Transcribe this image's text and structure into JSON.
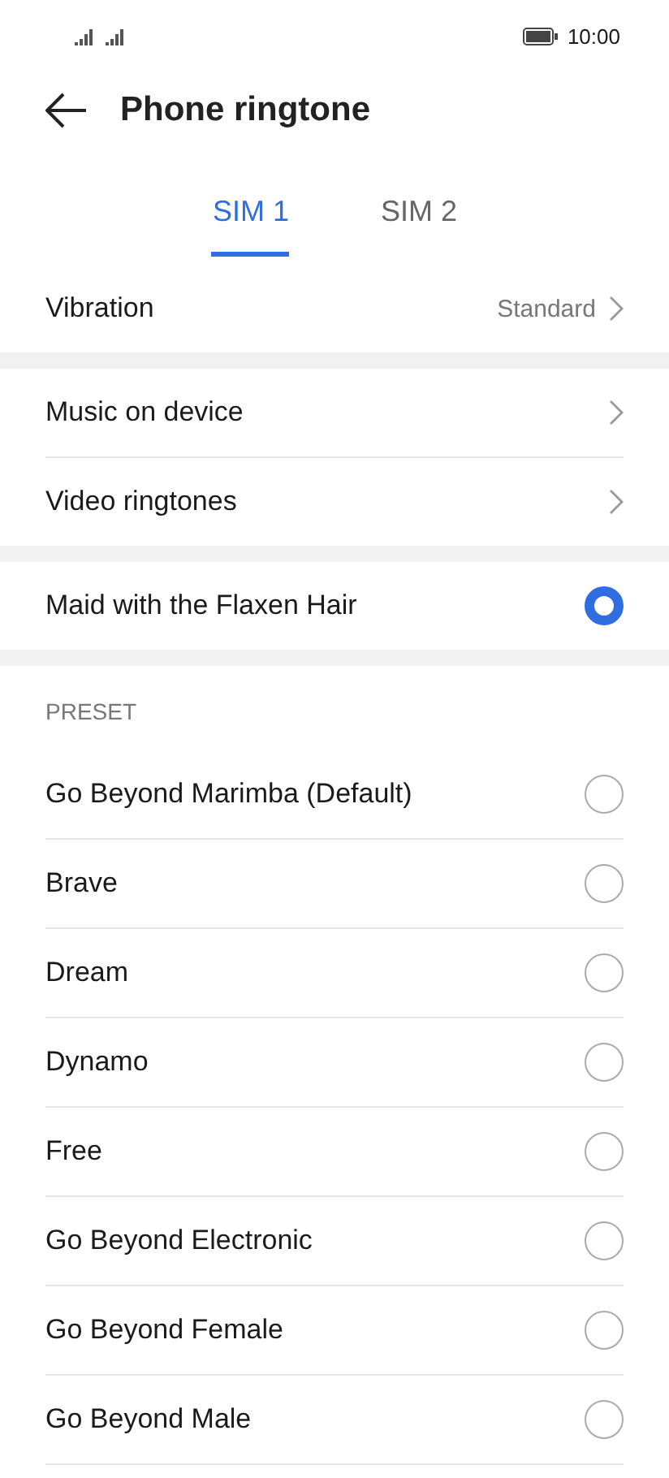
{
  "status_bar": {
    "time": "10:00"
  },
  "header": {
    "title": "Phone ringtone"
  },
  "tabs": [
    {
      "label": "SIM 1",
      "selected": true
    },
    {
      "label": "SIM 2",
      "selected": false
    }
  ],
  "vibration": {
    "label": "Vibration",
    "value": "Standard"
  },
  "sources": [
    {
      "label": "Music on device"
    },
    {
      "label": "Video ringtones"
    }
  ],
  "current": {
    "label": "Maid with the Flaxen Hair",
    "selected": true
  },
  "preset": {
    "heading": "PRESET",
    "items": [
      {
        "label": "Go Beyond Marimba (Default)",
        "selected": false
      },
      {
        "label": "Brave",
        "selected": false
      },
      {
        "label": "Dream",
        "selected": false
      },
      {
        "label": "Dynamo",
        "selected": false
      },
      {
        "label": "Free",
        "selected": false
      },
      {
        "label": "Go Beyond Electronic",
        "selected": false
      },
      {
        "label": "Go Beyond Female",
        "selected": false
      },
      {
        "label": "Go Beyond Male",
        "selected": false
      }
    ]
  }
}
